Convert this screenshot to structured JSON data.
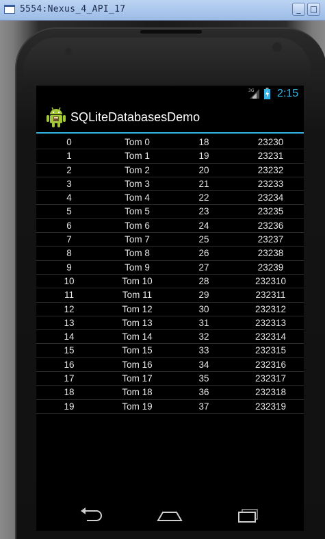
{
  "window": {
    "title": "5554:Nexus_4_API_17",
    "minimize_label": "_",
    "maximize_label": "□",
    "icon": "window-icon"
  },
  "status_bar": {
    "time": "2:15",
    "network_label": "3G",
    "icons": [
      "signal-icon",
      "battery-charging-icon"
    ],
    "accent": "#33b5e5"
  },
  "action_bar": {
    "title": "SQLiteDatabasesDemo",
    "icon": "android-app-icon"
  },
  "rows": [
    {
      "id": "0",
      "name": "Tom 0",
      "age": "18",
      "phone": "23230"
    },
    {
      "id": "1",
      "name": "Tom 1",
      "age": "19",
      "phone": "23231"
    },
    {
      "id": "2",
      "name": "Tom 2",
      "age": "20",
      "phone": "23232"
    },
    {
      "id": "3",
      "name": "Tom 3",
      "age": "21",
      "phone": "23233"
    },
    {
      "id": "4",
      "name": "Tom 4",
      "age": "22",
      "phone": "23234"
    },
    {
      "id": "5",
      "name": "Tom 5",
      "age": "23",
      "phone": "23235"
    },
    {
      "id": "6",
      "name": "Tom 6",
      "age": "24",
      "phone": "23236"
    },
    {
      "id": "7",
      "name": "Tom 7",
      "age": "25",
      "phone": "23237"
    },
    {
      "id": "8",
      "name": "Tom 8",
      "age": "26",
      "phone": "23238"
    },
    {
      "id": "9",
      "name": "Tom 9",
      "age": "27",
      "phone": "23239"
    },
    {
      "id": "10",
      "name": "Tom 10",
      "age": "28",
      "phone": "232310"
    },
    {
      "id": "11",
      "name": "Tom 11",
      "age": "29",
      "phone": "232311"
    },
    {
      "id": "12",
      "name": "Tom 12",
      "age": "30",
      "phone": "232312"
    },
    {
      "id": "13",
      "name": "Tom 13",
      "age": "31",
      "phone": "232313"
    },
    {
      "id": "14",
      "name": "Tom 14",
      "age": "32",
      "phone": "232314"
    },
    {
      "id": "15",
      "name": "Tom 15",
      "age": "33",
      "phone": "232315"
    },
    {
      "id": "16",
      "name": "Tom 16",
      "age": "34",
      "phone": "232316"
    },
    {
      "id": "17",
      "name": "Tom 17",
      "age": "35",
      "phone": "232317"
    },
    {
      "id": "18",
      "name": "Tom 18",
      "age": "36",
      "phone": "232318"
    },
    {
      "id": "19",
      "name": "Tom 19",
      "age": "37",
      "phone": "232319"
    }
  ],
  "nav_bar": {
    "icons": [
      "back-icon",
      "home-icon",
      "recent-apps-icon"
    ]
  }
}
